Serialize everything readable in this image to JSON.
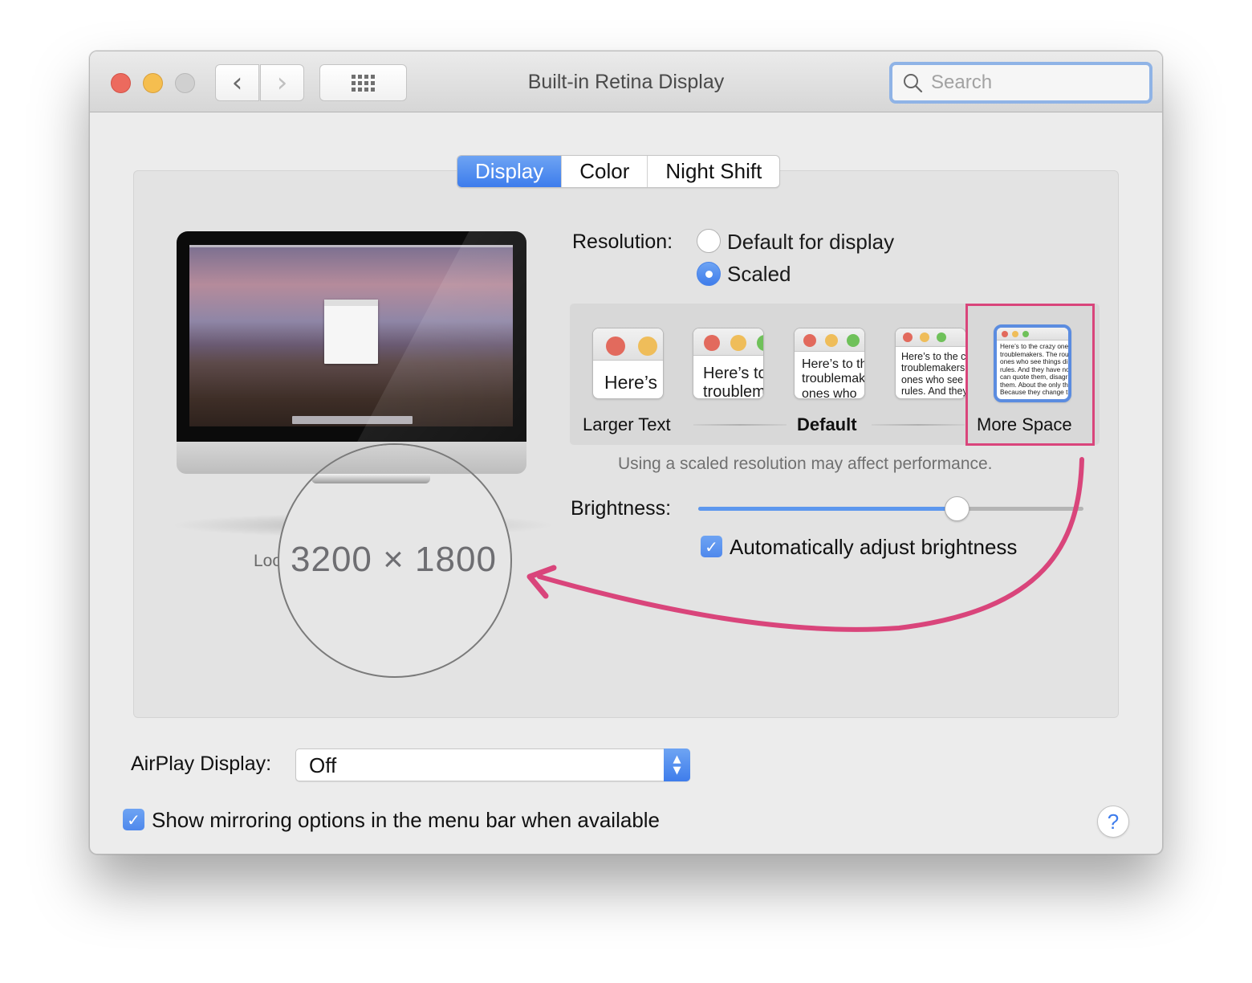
{
  "window": {
    "title": "Built-in Retina Display",
    "traffic_lights": [
      "close",
      "minimize",
      "zoom"
    ],
    "nav": {
      "back_icon": "chevron-left-icon",
      "forward_icon": "chevron-right-icon",
      "grid_icon": "show-all-grid-icon"
    },
    "search": {
      "placeholder": "Search",
      "value": "",
      "icon": "search-icon"
    }
  },
  "tabs": [
    {
      "label": "Display",
      "active": true
    },
    {
      "label": "Color",
      "active": false
    },
    {
      "label": "Night Shift",
      "active": false
    }
  ],
  "preview": {
    "label_partial": "Loo",
    "magnified_resolution": "3200 × 1800"
  },
  "resolution": {
    "label": "Resolution:",
    "options": [
      {
        "label": "Default for display",
        "selected": false
      },
      {
        "label": "Scaled",
        "selected": true
      }
    ],
    "scale_options": [
      {
        "sample_text": "Here’s",
        "selected": false
      },
      {
        "sample_text": "Here’s to\ntroublem",
        "selected": false
      },
      {
        "sample_text": "Here’s to th\ntroublemak\nones who",
        "selected": false
      },
      {
        "sample_text": "Here’s to the c\ntroublemakers\nones who see\nrules. And they",
        "selected": false
      },
      {
        "sample_text": "Here’s to the crazy ones\ntroublemakers. The rou\nones who see things di\nrules. And they have no\ncan quote them, disagr\nthem. About the only th\nBecause they change t",
        "selected": true
      }
    ],
    "captions": {
      "left": "Larger Text",
      "middle": "Default",
      "right": "More Space"
    },
    "note": "Using a scaled resolution may affect performance."
  },
  "brightness": {
    "label": "Brightness:",
    "value_percent": 67,
    "auto_adjust": {
      "label": "Automatically adjust brightness",
      "checked": true,
      "check_glyph": "✓"
    }
  },
  "airplay": {
    "label": "AirPlay Display:",
    "selected": "Off",
    "arrows": {
      "up": "⌃",
      "down": "⌄"
    }
  },
  "mirroring": {
    "label": "Show mirroring options in the menu bar when available",
    "checked": true,
    "check_glyph": "✓"
  },
  "help": {
    "glyph": "?"
  },
  "annotation": {
    "color": "#d9457b"
  }
}
